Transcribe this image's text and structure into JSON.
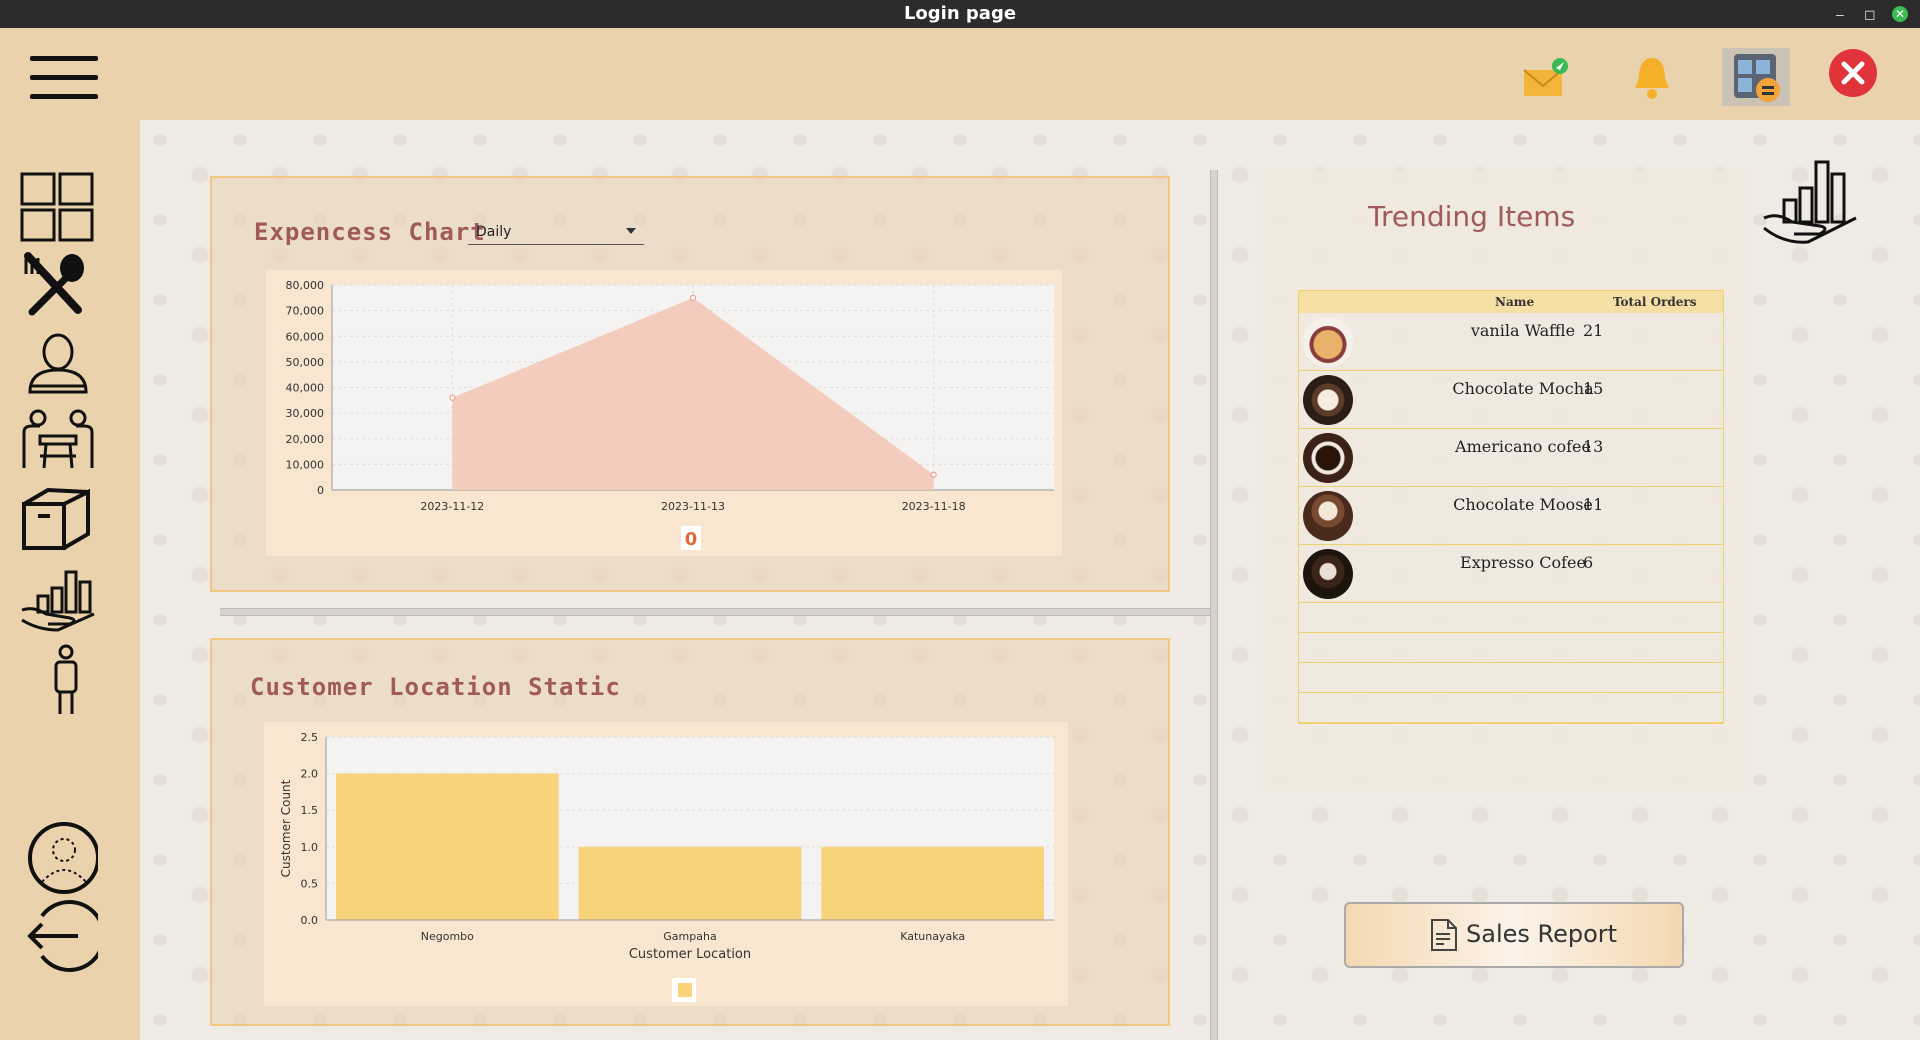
{
  "window": {
    "title": "Login page"
  },
  "expense": {
    "title": "Expencess Chart",
    "period": "Daily",
    "legend_badge": "0"
  },
  "location": {
    "title": "Customer Location Static"
  },
  "trending": {
    "title": "Trending Items",
    "headers": {
      "name": "Name",
      "orders": "Total Orders"
    },
    "rows": [
      {
        "name": "vanila Waffle",
        "orders": "21"
      },
      {
        "name": "Chocolate Mocha",
        "orders": "15"
      },
      {
        "name": "Americano cofee",
        "orders": "13"
      },
      {
        "name": "Chocolate Moose",
        "orders": "11"
      },
      {
        "name": "Expresso Cofee",
        "orders": "6"
      }
    ]
  },
  "sales_report": {
    "label": "Sales Report"
  },
  "colors": {
    "area_fill": "#f2c4b4",
    "area_line": "#e88c7c",
    "bar_fill": "#f9d37a",
    "accent_title": "#a05a5a"
  },
  "icons": {
    "header": [
      "mail-icon",
      "bell-icon",
      "calculator-icon",
      "close-icon"
    ],
    "sidebar": [
      "dashboard-icon",
      "food-icon",
      "user-icon",
      "table-icon",
      "package-icon",
      "sales-icon",
      "employee-icon",
      "profile-icon",
      "logout-icon"
    ]
  },
  "chart_data": [
    {
      "type": "area",
      "title": "",
      "xlabel": "",
      "ylabel": "",
      "x": [
        "2023-11-12",
        "2023-11-13",
        "2023-11-18"
      ],
      "values": [
        36000,
        75000,
        6000
      ],
      "ylim": [
        0,
        80000
      ],
      "yticks": [
        "0",
        "10,000",
        "20,000",
        "30,000",
        "40,000",
        "50,000",
        "60,000",
        "70,000",
        "80,000"
      ],
      "grid": true,
      "legend": "bottom"
    },
    {
      "type": "bar",
      "title": "",
      "xlabel": "Customer Location",
      "ylabel": "Customer Count",
      "categories": [
        "Negombo",
        "Gampaha",
        "Katunayaka"
      ],
      "values": [
        2.0,
        1.0,
        1.0
      ],
      "ylim": [
        0,
        2.5
      ],
      "yticks": [
        "0.0",
        "0.5",
        "1.0",
        "1.5",
        "2.0",
        "2.5"
      ],
      "grid": true,
      "legend": "bottom"
    }
  ]
}
